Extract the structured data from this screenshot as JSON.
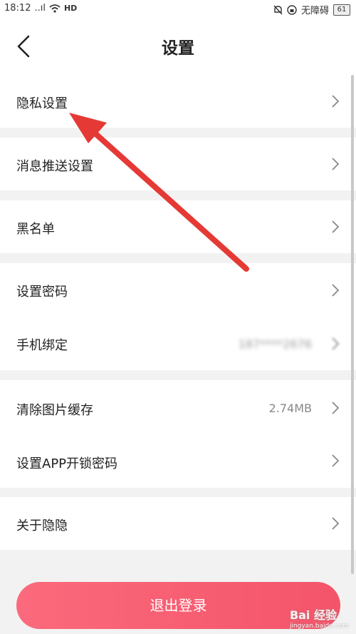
{
  "status_bar": {
    "time": "18:12",
    "signal": "..ıl",
    "hd": "HD",
    "accessibility": "无障碍",
    "battery": "61"
  },
  "header": {
    "title": "设置"
  },
  "groups": [
    {
      "rows": [
        {
          "label": "隐私设置"
        }
      ]
    },
    {
      "rows": [
        {
          "label": "消息推送设置"
        }
      ]
    },
    {
      "rows": [
        {
          "label": "黑名单"
        }
      ]
    },
    {
      "rows": [
        {
          "label": "设置密码"
        },
        {
          "label": "手机绑定",
          "value": "187****2676"
        }
      ]
    },
    {
      "rows": [
        {
          "label": "清除图片缓存",
          "value": "2.74MB"
        },
        {
          "label": "设置APP开锁密码"
        }
      ]
    },
    {
      "rows": [
        {
          "label": "关于隐隐"
        }
      ]
    }
  ],
  "logout_label": "退出登录",
  "watermark": {
    "text": "Bai 经验",
    "url": "jingyan.baidu.com"
  },
  "colors": {
    "accent": "#f45469",
    "arrow": "#e53935"
  }
}
